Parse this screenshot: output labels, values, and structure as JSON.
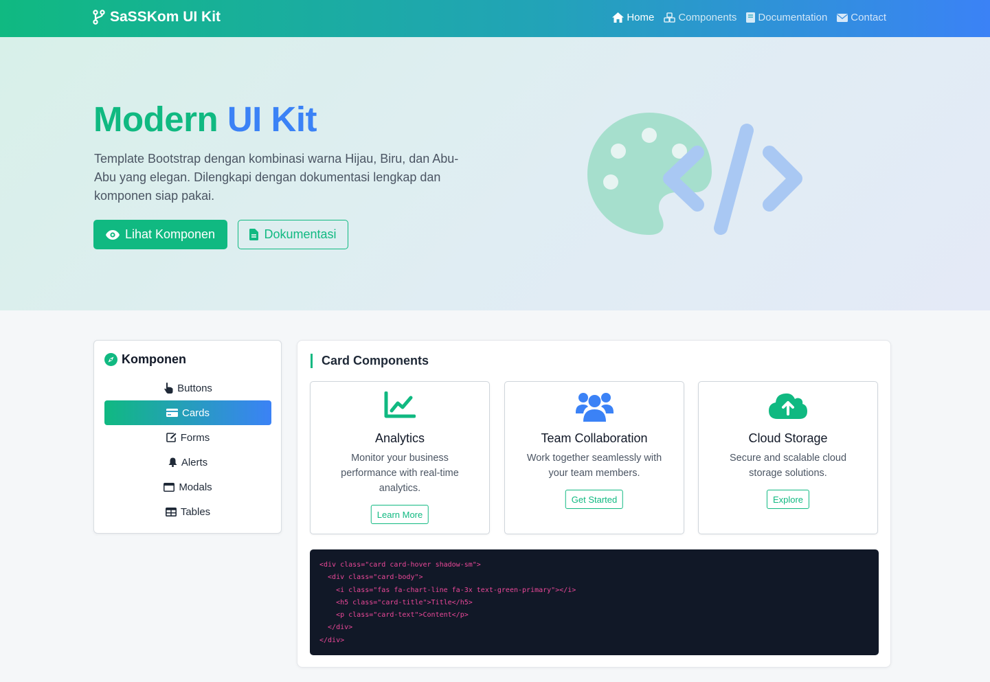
{
  "navbar": {
    "brand": "SaSSKom UI Kit",
    "links": [
      {
        "label": "Home",
        "icon": "home-icon",
        "active": true
      },
      {
        "label": "Components",
        "icon": "cubes-icon"
      },
      {
        "label": "Documentation",
        "icon": "book-icon"
      },
      {
        "label": "Contact",
        "icon": "envelope-icon"
      }
    ]
  },
  "hero": {
    "title_part1": "Modern",
    "title_part2": "UI Kit",
    "text": "Template Bootstrap dengan kombinasi warna Hijau, Biru, dan Abu-Abu yang elegan. Dilengkapi dengan dokumentasi lengkap dan komponen siap pakai.",
    "btn_primary": "Lihat Komponen",
    "btn_outline": "Dokumentasi"
  },
  "sidebar": {
    "title": "Komponen",
    "items": [
      {
        "label": "Buttons",
        "icon": "pointer-icon"
      },
      {
        "label": "Cards",
        "icon": "card-icon",
        "active": true
      },
      {
        "label": "Forms",
        "icon": "edit-icon"
      },
      {
        "label": "Alerts",
        "icon": "bell-icon"
      },
      {
        "label": "Modals",
        "icon": "window-icon"
      },
      {
        "label": "Tables",
        "icon": "table-icon"
      }
    ]
  },
  "main": {
    "title": "Card Components",
    "cards": [
      {
        "title": "Analytics",
        "text": "Monitor your business performance with real-time analytics.",
        "button": "Learn More",
        "icon": "chart-line-icon"
      },
      {
        "title": "Team Collaboration",
        "text": "Work together seamlessly with your team members.",
        "button": "Get Started",
        "icon": "users-icon"
      },
      {
        "title": "Cloud Storage",
        "text": "Secure and scalable cloud storage solutions.",
        "button": "Explore",
        "icon": "cloud-upload-icon"
      }
    ],
    "code": "<div class=\"card card-hover shadow-sm\">\n  <div class=\"card-body\">\n    <i class=\"fas fa-chart-line fa-3x text-green-primary\"></i>\n    <h5 class=\"card-title\">Title</h5>\n    <p class=\"card-text\">Content</p>\n  </div>\n</div>"
  },
  "colors": {
    "green": "#10b981",
    "blue": "#3b82f6",
    "code_bg": "#111827",
    "code_text": "#ec4899"
  }
}
